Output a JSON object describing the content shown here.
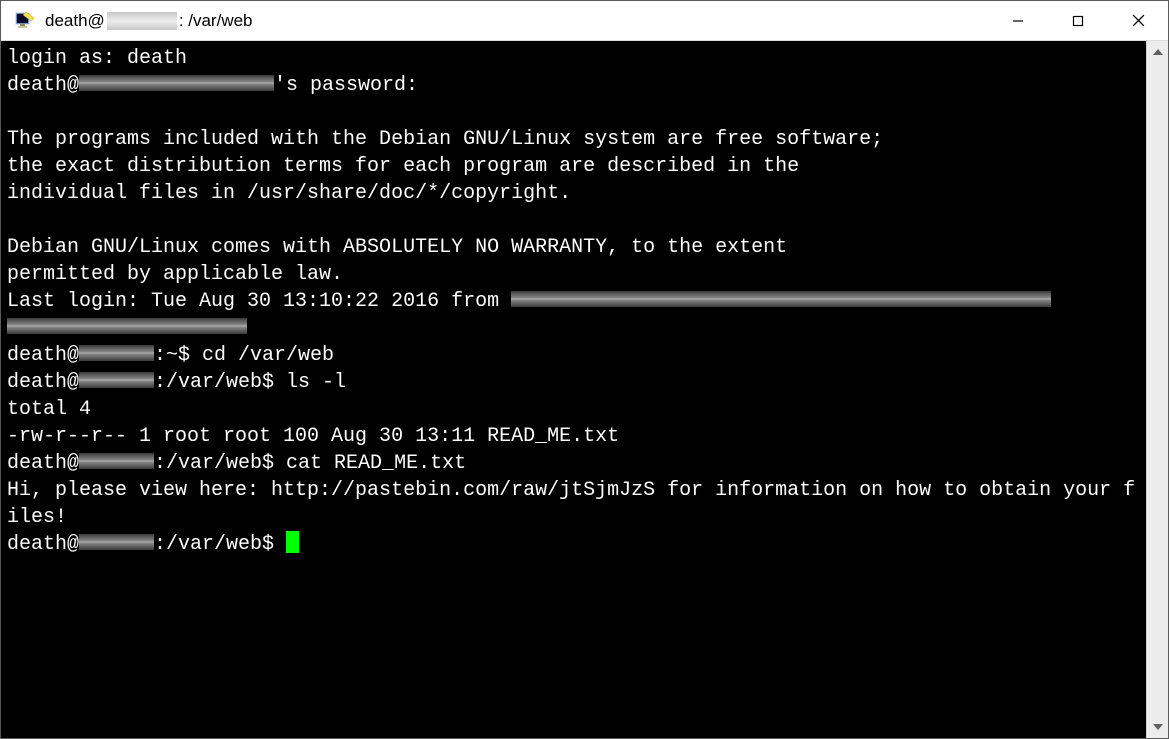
{
  "window": {
    "title_prefix": "death@",
    "title_suffix": ": /var/web"
  },
  "terminal": {
    "login_prompt": "login as: ",
    "login_user": "death",
    "pw_prefix": "death@",
    "pw_suffix": "'s password:",
    "motd1": "The programs included with the Debian GNU/Linux system are free software;",
    "motd2": "the exact distribution terms for each program are described in the",
    "motd3": "individual files in /usr/share/doc/*/copyright.",
    "motd4": "Debian GNU/Linux comes with ABSOLUTELY NO WARRANTY, to the extent",
    "motd5": "permitted by applicable law.",
    "last_login_prefix": "Last login: Tue Aug 30 13:10:22 2016 from ",
    "prompt1_prefix": "death@",
    "prompt1_suffix": ":~$ ",
    "cmd1": "cd /var/web",
    "prompt2_prefix": "death@",
    "prompt2_suffix": ":/var/web$ ",
    "cmd2": "ls -l",
    "ls_total": "total 4",
    "ls_line": "-rw-r--r-- 1 root root 100 Aug 30 13:11 READ_ME.txt",
    "prompt3_prefix": "death@",
    "prompt3_suffix": ":/var/web$ ",
    "cmd3": "cat READ_ME.txt",
    "cat_output": "Hi, please view here: http://pastebin.com/raw/jtSjmJzS for information on how to obtain your files!",
    "prompt4_prefix": "death@",
    "prompt4_suffix": ":/var/web$ "
  }
}
